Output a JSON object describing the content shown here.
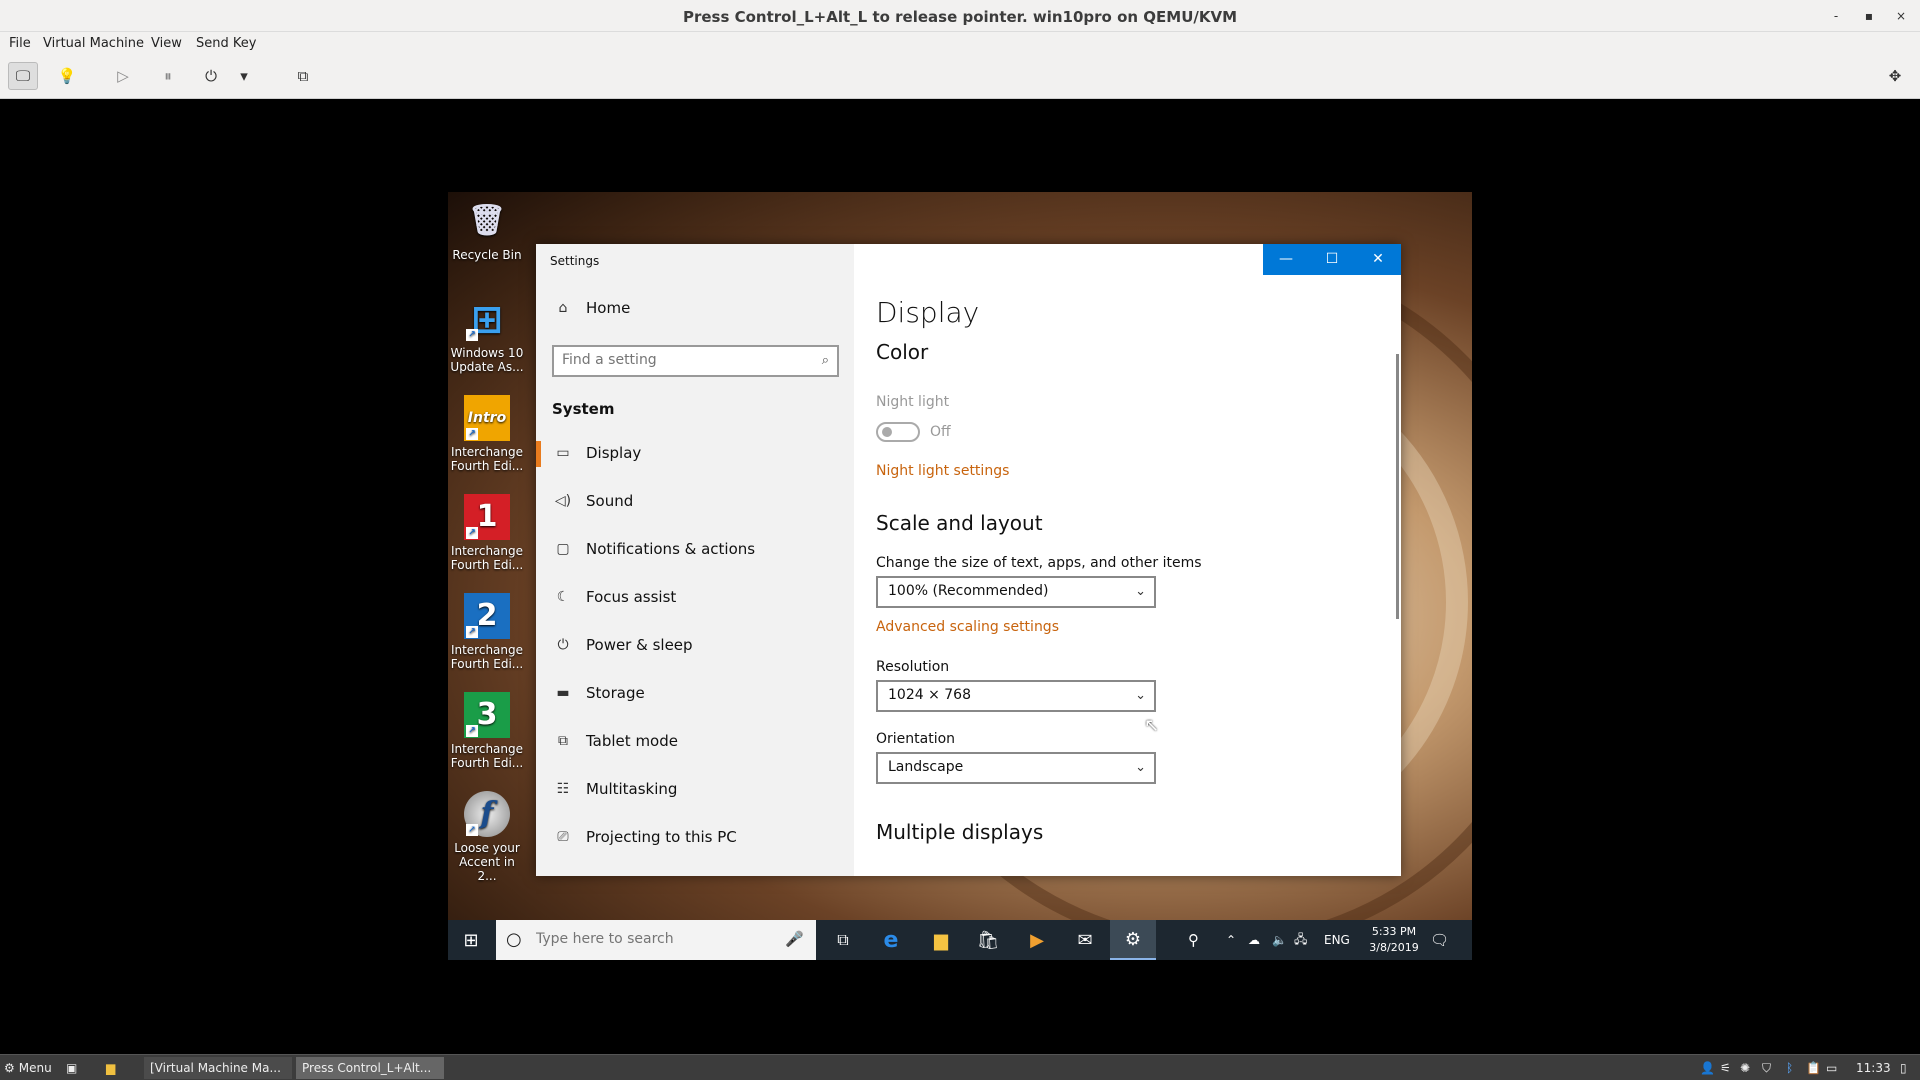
{
  "host": {
    "title": "Press Control_L+Alt_L to release pointer. win10pro on QEMU/KVM",
    "menus": [
      "File",
      "Virtual Machine",
      "View",
      "Send Key"
    ],
    "toolbar_icons": [
      "monitor-icon",
      "lightbulb-icon",
      "play-icon",
      "pause-icon",
      "power-icon",
      "dropdown-icon",
      "snapshot-icon"
    ],
    "fullscreen_icon": "fullscreen-icon",
    "window_controls": [
      "-",
      "▪",
      "×"
    ]
  },
  "desktop": {
    "icons": [
      {
        "label": "Recycle Bin",
        "glyph": "🗑",
        "color": "transparent"
      },
      {
        "label": "Windows 10 Update As...",
        "glyph": "⊞",
        "color": "transparent"
      },
      {
        "label": "Interchange Fourth Edi...",
        "glyph": "Intro",
        "color": "#f0a500"
      },
      {
        "label": "Interchange Fourth Edi...",
        "glyph": "1",
        "color": "#d41f26"
      },
      {
        "label": "Interchange Fourth Edi...",
        "glyph": "2",
        "color": "#1a6fc1"
      },
      {
        "label": "Interchange Fourth Edi...",
        "glyph": "3",
        "color": "#1a9d48"
      },
      {
        "label": "Loose your Accent in 2...",
        "glyph": "f",
        "color": "#c8c8c8"
      }
    ]
  },
  "settings": {
    "window_title": "Settings",
    "home": "Home",
    "search_placeholder": "Find a setting",
    "section": "System",
    "nav": [
      {
        "label": "Display",
        "icon": "▭"
      },
      {
        "label": "Sound",
        "icon": "◁)"
      },
      {
        "label": "Notifications & actions",
        "icon": "▢"
      },
      {
        "label": "Focus assist",
        "icon": "☾"
      },
      {
        "label": "Power & sleep",
        "icon": "⏻"
      },
      {
        "label": "Storage",
        "icon": "▬"
      },
      {
        "label": "Tablet mode",
        "icon": "⧉"
      },
      {
        "label": "Multitasking",
        "icon": "☷"
      },
      {
        "label": "Projecting to this PC",
        "icon": "⎚"
      }
    ],
    "content": {
      "title": "Display",
      "color_hdr": "Color",
      "night_light": "Night light",
      "night_state": "Off",
      "night_settings_link": "Night light settings",
      "scale_hdr": "Scale and layout",
      "scale_label": "Change the size of text, apps, and other items",
      "scale_value": "100% (Recommended)",
      "adv_link": "Advanced scaling settings",
      "res_label": "Resolution",
      "res_value": "1024 × 768",
      "orient_label": "Orientation",
      "orient_value": "Landscape",
      "multi_hdr": "Multiple displays"
    }
  },
  "win_taskbar": {
    "search_placeholder": "Type here to search",
    "lang": "ENG",
    "time": "5:33 PM",
    "date": "3/8/2019"
  },
  "host_taskbar": {
    "menu": "Menu",
    "tasks": [
      "[Virtual Machine Ma...",
      "Press Control_L+Alt..."
    ],
    "clock": "11:33"
  }
}
